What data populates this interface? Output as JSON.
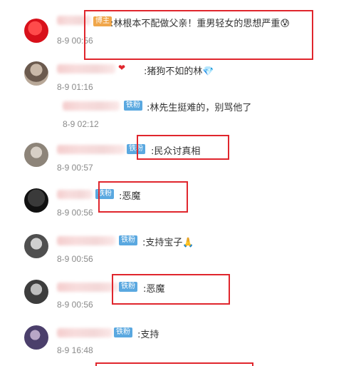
{
  "comments": [
    {
      "badge": "博主",
      "text": ":林根本不配做父亲！重男轻女的思想严重",
      "emoji": "😰",
      "time": "8-9 00:56"
    },
    {
      "text": ":猪狗不如的林",
      "emoji": "💎",
      "time": "8-9 01:16"
    },
    {
      "badge": "铁粉",
      "text": ":林先生挺难的，别骂他了",
      "time": "8-9 02:12"
    },
    {
      "badge": "铁粉",
      "text": ":民众讨真相",
      "time": "8-9 00:57"
    },
    {
      "badge": "铁粉",
      "text": ":恶魔",
      "time": "8-9 00:56"
    },
    {
      "badge": "铁粉",
      "text": ":支持宝子",
      "emoji": "🙏",
      "time": "8-9 00:56"
    },
    {
      "badge": "铁粉",
      "text": ":恶魔",
      "time": "8-9 00:56"
    },
    {
      "badge": "铁粉",
      "text": ":支持",
      "time": "8-9 16:48"
    }
  ],
  "colors": {
    "highlight": "#e0262d",
    "badge_fan": "#5aa8e0",
    "badge_host": "#f0a64a"
  }
}
